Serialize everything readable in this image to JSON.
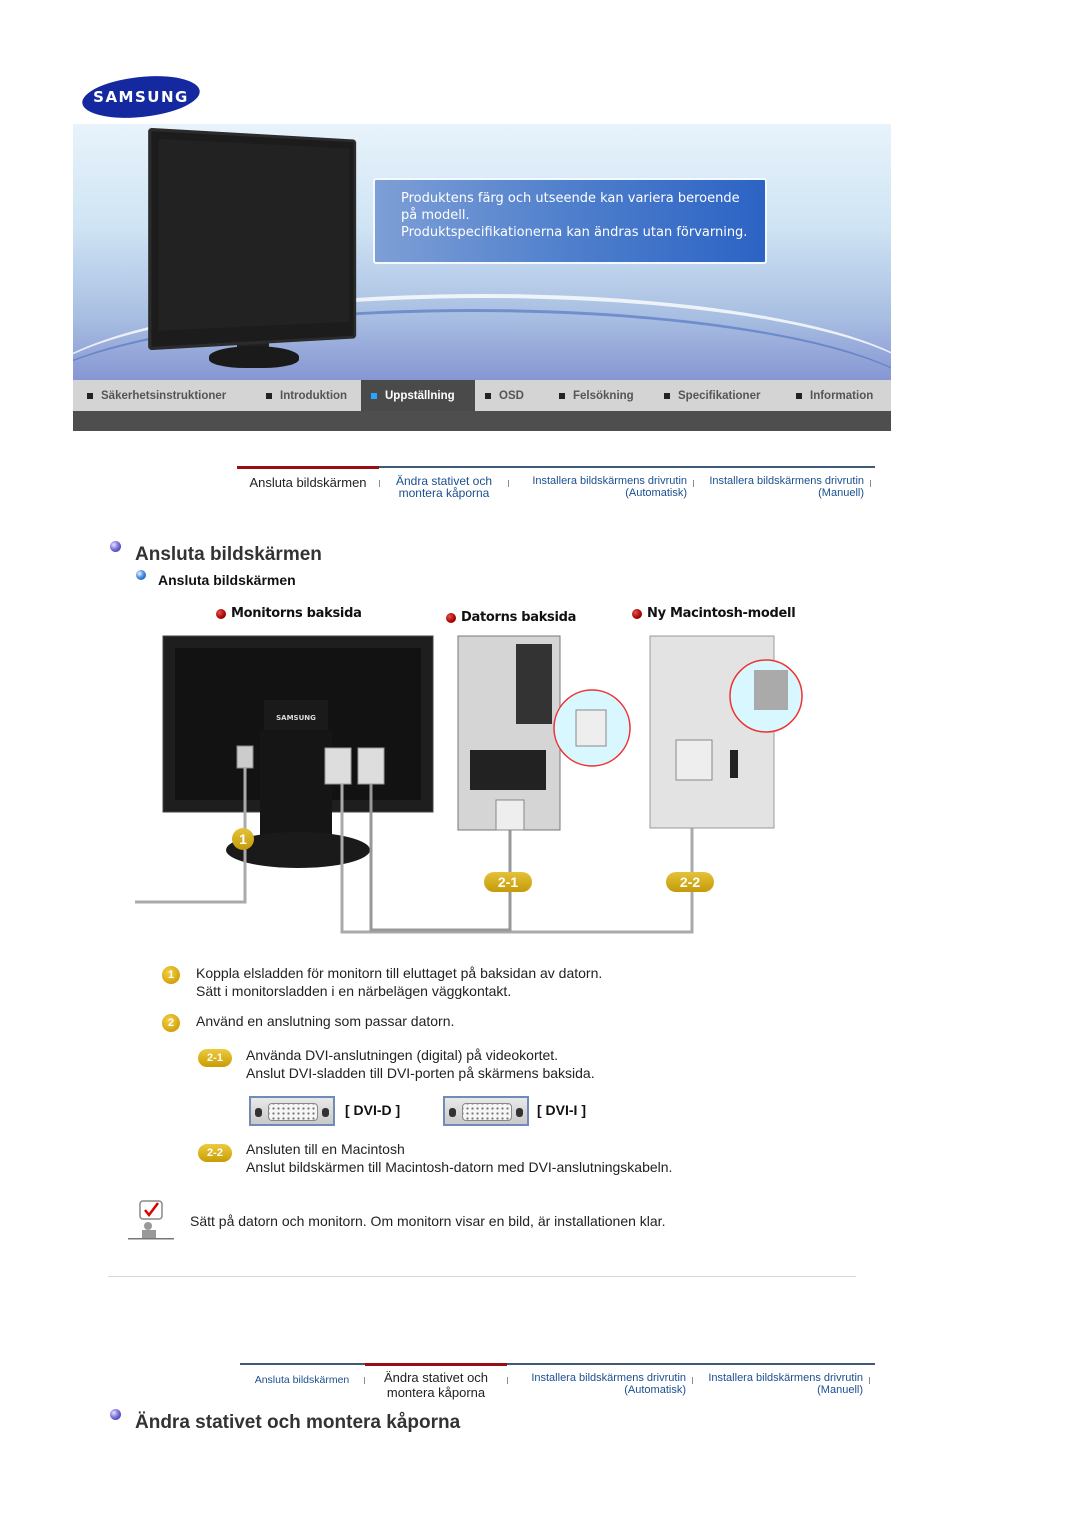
{
  "brand": {
    "logo_text": "SAMSUNG",
    "color": "#1428a0"
  },
  "banner": {
    "notice_lines": [
      "Produktens färg och utseende kan variera beroende",
      "på modell.",
      "Produktspecifikationerna kan ändras utan förvarning."
    ]
  },
  "nav": {
    "items": [
      {
        "label": "Säkerhetsinstruktioner",
        "active": false
      },
      {
        "label": "Introduktion",
        "active": false
      },
      {
        "label": "Uppställning",
        "active": true
      },
      {
        "label": "OSD",
        "active": false
      },
      {
        "label": "Felsökning",
        "active": false
      },
      {
        "label": "Specifikationer",
        "active": false
      },
      {
        "label": "Information",
        "active": false
      }
    ],
    "active_color": "#2aa4ff"
  },
  "subtabs_top": [
    {
      "line1": "Ansluta bildskärmen",
      "line2": "",
      "active": true
    },
    {
      "line1": "Ändra stativet och",
      "line2": "montera kåporna",
      "active": false
    },
    {
      "line1": "Installera bildskärmens drivrutin",
      "line2": "(Automatisk)",
      "active": false
    },
    {
      "line1": "Installera bildskärmens drivrutin",
      "line2": "(Manuell)",
      "active": false
    }
  ],
  "section1": {
    "title": "Ansluta bildskärmen",
    "subtitle": "Ansluta bildskärmen",
    "diagram": {
      "labels": [
        "Monitorns baksida",
        "Datorns baksida",
        "Ny Macintosh-modell"
      ],
      "badges": [
        "1",
        "2-1",
        "2-2"
      ],
      "monitor_brand": "SAMSUNG"
    },
    "steps": [
      {
        "badge": "1",
        "lines": [
          "Koppla elsladden för monitorn till eluttaget på baksidan av datorn.",
          "Sätt i monitorsladden i en närbelägen väggkontakt."
        ]
      },
      {
        "badge": "2",
        "lines": [
          "Använd en anslutning som passar datorn."
        ]
      },
      {
        "badge": "2-1",
        "lines": [
          "Använda DVI-anslutningen (digital) på videokortet.",
          "Anslut DVI-sladden till DVI-porten på skärmens baksida."
        ]
      },
      {
        "badge": "2-2",
        "lines": [
          "Ansluten till en Macintosh",
          "Anslut bildskärmen till Macintosh-datorn med DVI-anslutningskabeln."
        ]
      }
    ],
    "ports": [
      {
        "label": "[ DVI-D ]"
      },
      {
        "label": "[ DVI-I ]"
      }
    ],
    "note": "Sätt på datorn och monitorn. Om monitorn visar en bild, är installationen klar."
  },
  "subtabs_bottom": [
    {
      "line1": "Ansluta bildskärmen",
      "line2": "",
      "active": false
    },
    {
      "line1": "Ändra stativet och",
      "line2": "montera kåporna",
      "active": true
    },
    {
      "line1": "Installera bildskärmens drivrutin",
      "line2": "(Automatisk)",
      "active": false
    },
    {
      "line1": "Installera bildskärmens drivrutin",
      "line2": "(Manuell)",
      "active": false
    }
  ],
  "section2": {
    "title": "Ändra stativet och montera kåporna"
  }
}
